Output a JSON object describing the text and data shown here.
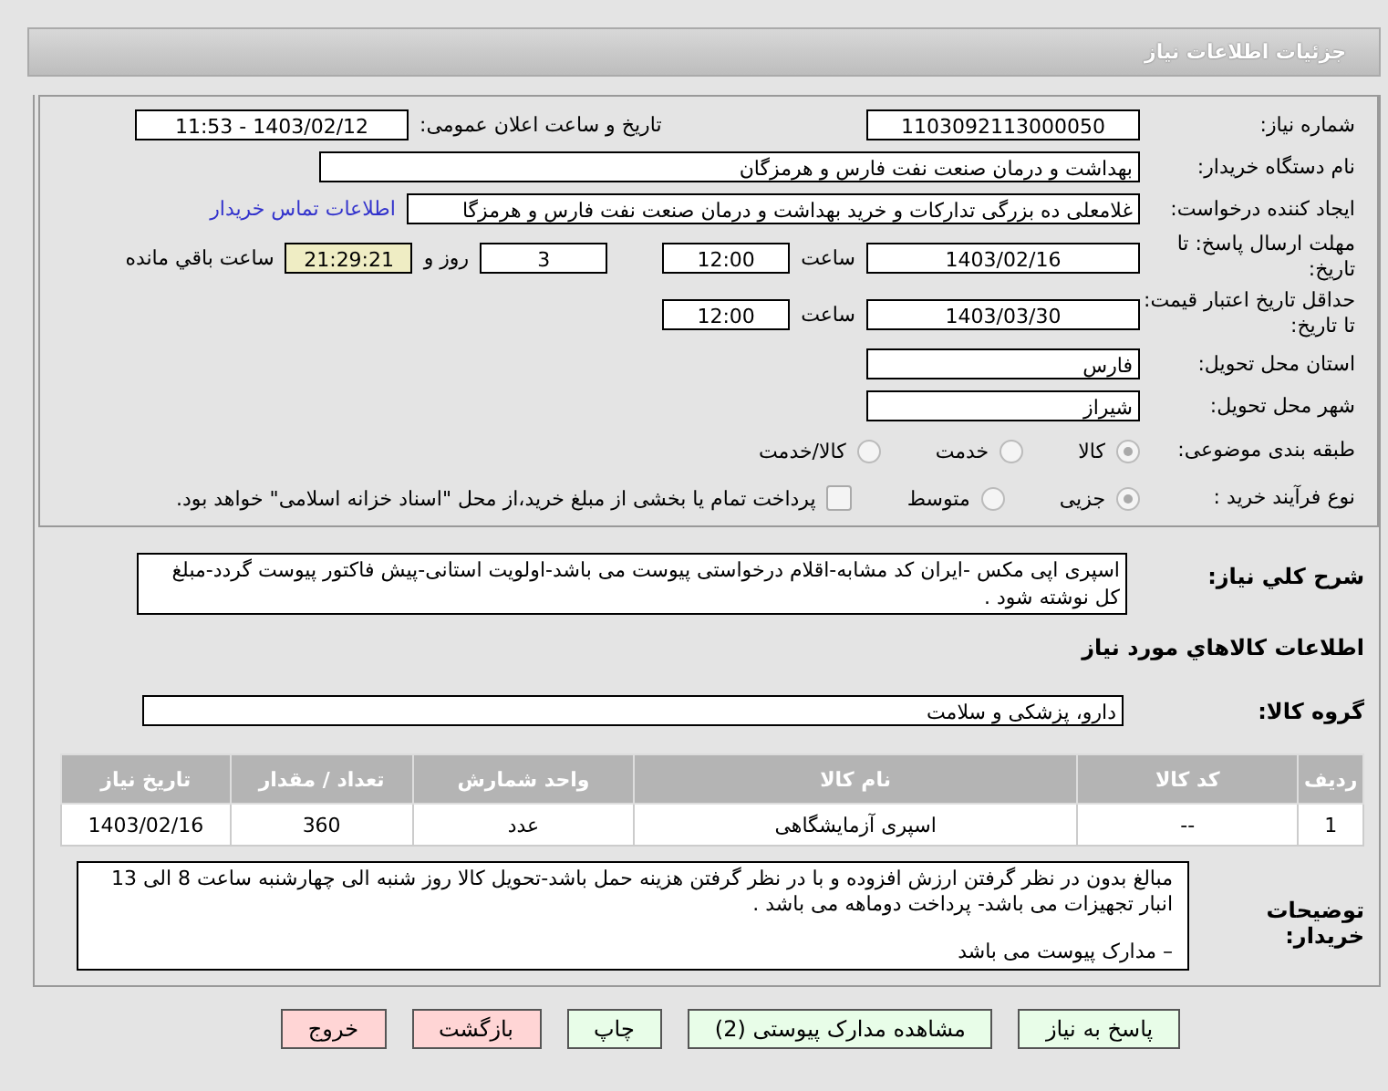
{
  "header": {
    "title": "جزئیات اطلاعات نیاز"
  },
  "form": {
    "need_number": {
      "label": "شماره نیاز:",
      "value": "1103092113000050"
    },
    "announce": {
      "label": "تاریخ و ساعت اعلان عمومی:",
      "value": "1403/02/12 - 11:53"
    },
    "buyer": {
      "label": "نام دستگاه خریدار:",
      "value": "بهداشت و درمان صنعت نفت فارس و هرمزگان"
    },
    "creator": {
      "label": "ایجاد کننده درخواست:",
      "value": "غلامعلی ده بزرگی تدارکات و خرید بهداشت و درمان صنعت نفت فارس و هرمزگا",
      "link": "اطلاعات تماس خریدار"
    },
    "deadline": {
      "label": "مهلت ارسال پاسخ: تا تاریخ:",
      "date": "1403/02/16",
      "time_label": "ساعت",
      "time": "12:00",
      "days": "3",
      "days_label": "روز و",
      "remaining": "21:29:21",
      "remaining_label": "ساعت باقي مانده"
    },
    "validity": {
      "label": "حداقل تاریخ اعتبار قیمت: تا تاریخ:",
      "date": "1403/03/30",
      "time_label": "ساعت",
      "time": "12:00"
    },
    "province": {
      "label": "استان محل تحویل:",
      "value": "فارس"
    },
    "city": {
      "label": "شهر محل تحویل:",
      "value": "شیراز"
    },
    "category": {
      "label": "طبقه بندی موضوعی:",
      "options": [
        {
          "label": "کالا",
          "selected": true
        },
        {
          "label": "خدمت",
          "selected": false
        },
        {
          "label": "کالا/خدمت",
          "selected": false
        }
      ]
    },
    "process": {
      "label": "نوع فرآیند خرید :",
      "options": [
        {
          "label": "جزیی",
          "selected": true
        },
        {
          "label": "متوسط",
          "selected": false
        }
      ],
      "treasury": {
        "label": "پرداخت تمام یا بخشی از مبلغ خرید،از محل \"اسناد خزانه اسلامی\" خواهد بود.",
        "checked": false
      }
    }
  },
  "summary": {
    "label": "شرح کلي نیاز:",
    "value": "اسپری اپی مکس -ایران کد مشابه-اقلام درخواستی پیوست می باشد-اولویت استانی-پیش فاکتور پیوست گردد-مبلغ کل نوشته شود ."
  },
  "goods_title": "اطلاعات کالاهاي مورد نیاز",
  "goods_group": {
    "label": "گروه کالا:",
    "value": "دارو، پزشکی و سلامت"
  },
  "table": {
    "columns": [
      "ردیف",
      "کد کالا",
      "نام کالا",
      "واحد شمارش",
      "تعداد / مقدار",
      "تاریخ نیاز"
    ],
    "rows": [
      [
        "1",
        "--",
        "اسپری آزمایشگاهی",
        "عدد",
        "360",
        "1403/02/16"
      ]
    ]
  },
  "notes": {
    "label": "توضیحات خریدار:",
    "lines": [
      "مبالغ بدون در نظر گرفتن ارزش افزوده و با در نظر گرفتن هزینه حمل باشد-تحویل کالا روز شنبه الی چهارشنبه ساعت 8 الی 13 انبار تجهیزات می باشد- پرداخت دوماهه می باشد .",
      "– مدارک پیوست می باشد"
    ]
  },
  "buttons": [
    {
      "label": "پاسخ به نیاز",
      "kind": "normal"
    },
    {
      "label": "مشاهده مدارک پیوستی (2)",
      "kind": "normal"
    },
    {
      "label": "چاپ",
      "kind": "normal"
    },
    {
      "label": "بازگشت",
      "kind": "exit"
    },
    {
      "label": "خروج",
      "kind": "exit"
    }
  ]
}
